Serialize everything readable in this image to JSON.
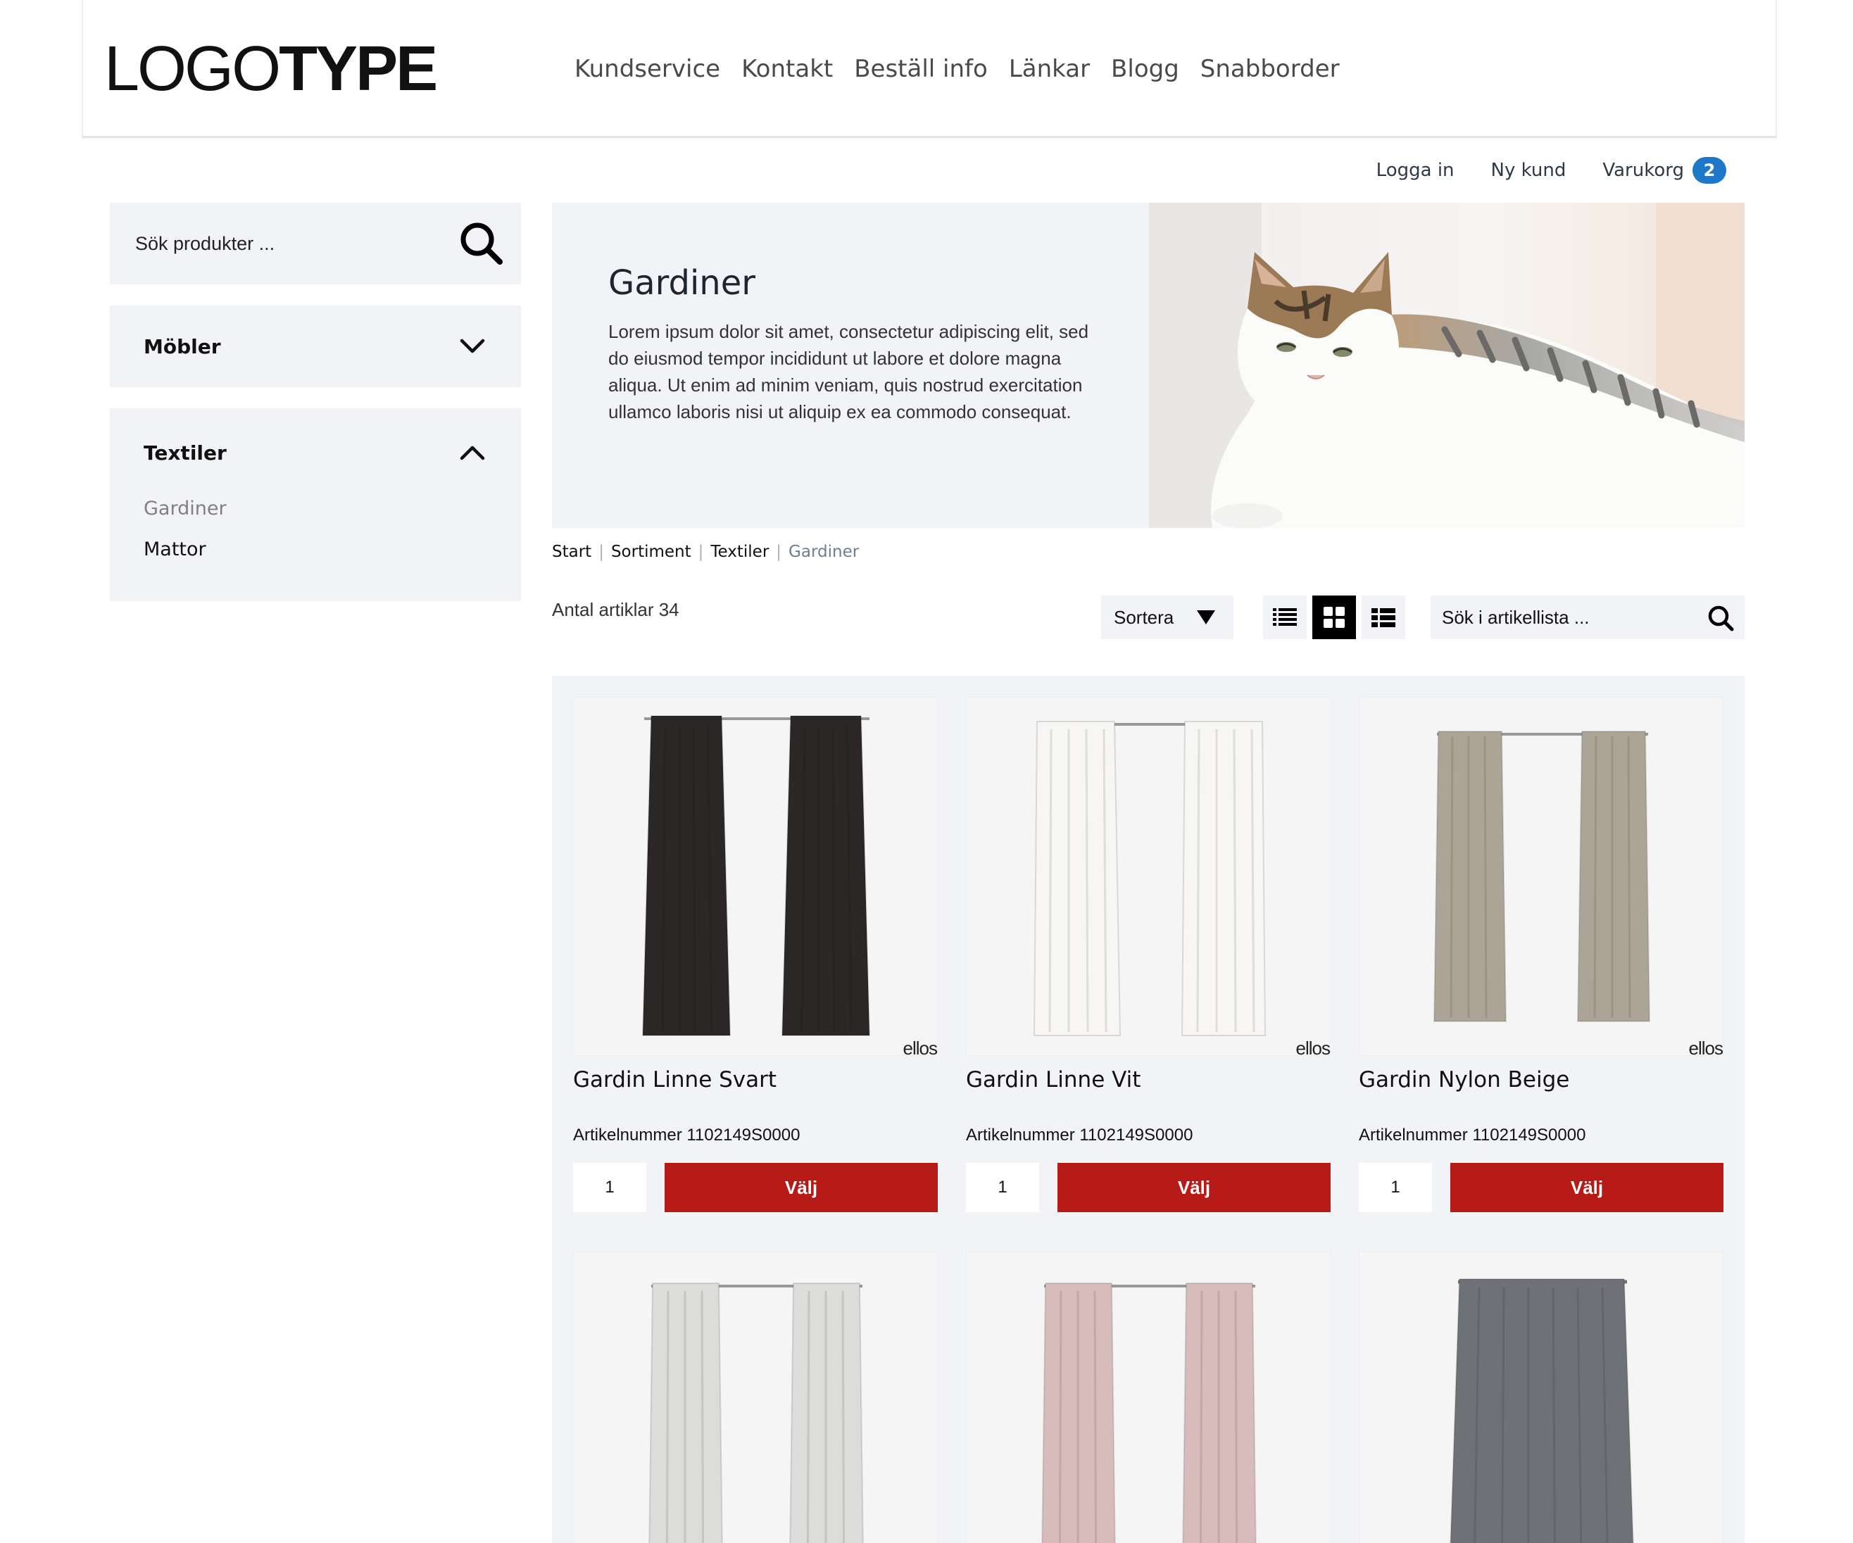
{
  "header": {
    "logo_light": "LOGO",
    "logo_bold": "TYPE",
    "nav": [
      "Kundservice",
      "Kontakt",
      "Beställ info",
      "Länkar",
      "Blogg",
      "Snabborder"
    ]
  },
  "account": {
    "login": "Logga in",
    "new_customer": "Ny kund",
    "cart": "Varukorg",
    "cart_count": "2"
  },
  "sidebar": {
    "search_placeholder": "Sök produkter ...",
    "categories": [
      {
        "title": "Möbler",
        "open": false
      },
      {
        "title": "Textiler",
        "open": true,
        "items": [
          "Gardiner",
          "Mattor"
        ],
        "active_item": "Gardiner"
      }
    ]
  },
  "hero": {
    "title": "Gardiner",
    "body": "Lorem ipsum dolor sit amet, consectetur adipiscing elit, sed do eiusmod tempor incididunt ut labore et dolore magna aliqua. Ut enim ad minim veniam, quis nostrud exercitation ullamco laboris nisi ut aliquip ex ea commodo consequat."
  },
  "breadcrumb": [
    "Start",
    "Sortiment",
    "Textiler",
    "Gardiner"
  ],
  "toolbar": {
    "count_label": "Antal artiklar 34",
    "sort_label": "Sortera",
    "list_search_placeholder": "Sök i artikellista ...",
    "active_view": "grid"
  },
  "products": [
    {
      "name": "Gardin Linne Svart",
      "article": "Artikelnummer 1102149S0000",
      "qty": "1",
      "button": "Välj",
      "brand": "ellos",
      "color": "#2b2726"
    },
    {
      "name": "Gardin Linne Vit",
      "article": "Artikelnummer 1102149S0000",
      "qty": "1",
      "button": "Välj",
      "brand": "ellos",
      "color": "#f7f6f4"
    },
    {
      "name": "Gardin Nylon Beige",
      "article": "Artikelnummer 1102149S0000",
      "qty": "1",
      "button": "Välj",
      "brand": "ellos",
      "color": "#aca597"
    },
    {
      "color": "#dcdcda"
    },
    {
      "color": "#d8bbbb"
    },
    {
      "color": "#6e7175"
    }
  ],
  "colors": {
    "panel": "#f2f3f6",
    "accent_button": "#b71b17",
    "badge": "#1d78c9"
  }
}
